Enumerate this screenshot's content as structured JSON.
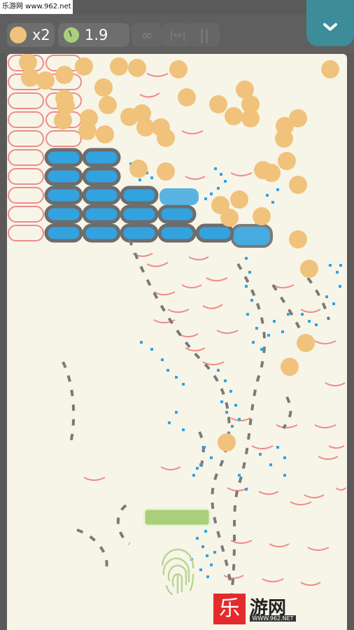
{
  "watermark": {
    "text": "乐游网 www.962.net"
  },
  "hud": {
    "coin_multiplier": "x2",
    "timer": "1.9",
    "infinity_symbol": "∞",
    "width_symbol": "|↔|",
    "pause_symbol": "||"
  },
  "colors": {
    "coin": "#f0c27b",
    "paddle": "#a9cf7a",
    "brick_outline": "#f08a8a",
    "water_block": "#33a3e0",
    "accent_tab": "#3d8c99",
    "background": "#f7f5e8"
  },
  "icons": [
    "coin-icon",
    "clock-icon",
    "infinity-icon",
    "width-icon",
    "pause-icon",
    "chevron-down-icon",
    "fingerprint-icon"
  ],
  "logo": {
    "mark": "乐",
    "name": "游网",
    "url": "WWW.962.NET"
  }
}
